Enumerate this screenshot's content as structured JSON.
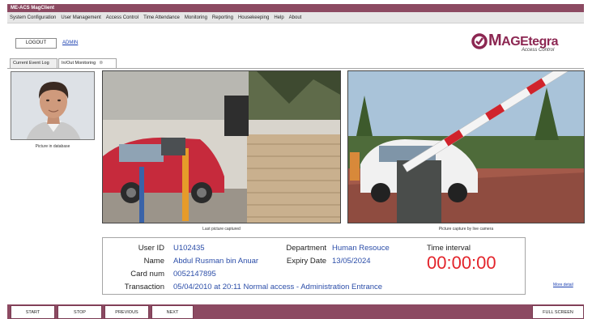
{
  "app": {
    "title": "ME-ACS MagClient"
  },
  "menu": [
    "System Configuration",
    "User Management",
    "Access Control",
    "Time Attendance",
    "Monitoring",
    "Reporting",
    "Housekeeping",
    "Help",
    "About"
  ],
  "header": {
    "logout_label": "LOGOUT",
    "user_link": "ADMIN"
  },
  "logo": {
    "brand_prefix": "M",
    "brand_rest": "AGEtegra",
    "subtitle": "Access Control"
  },
  "tabs": [
    {
      "label": "Current Event Log",
      "active": false
    },
    {
      "label": "In/Out Monitoring",
      "active": true
    }
  ],
  "captions": {
    "database_photo": "Picture in database",
    "last_captured": "Last picture captured",
    "live_camera": "Picture capture by live camera"
  },
  "record": {
    "labels": {
      "user_id": "User ID",
      "name": "Name",
      "card_num": "Card num",
      "transaction": "Transaction",
      "department": "Department",
      "expiry_date": "Expiry Date",
      "time_interval": "Time interval"
    },
    "user_id": "U102435",
    "name": "Abdul Rusman bin Anuar",
    "card_num": "0052147895",
    "transaction": "05/04/2010 at 20:11 Normal access - Administration Entrance",
    "department": "Human Resouce",
    "expiry_date": "13/05/2024",
    "time_interval": "00:00:00"
  },
  "links": {
    "more_detail": "More detail"
  },
  "controls": {
    "start": "START",
    "stop": "STOP",
    "previous": "PREVIOUS",
    "next": "NEXT",
    "full_screen": "FULL SCREEN"
  },
  "colors": {
    "brand": "#8c4a62",
    "value_text": "#2b4da8",
    "timer": "#e3242b"
  }
}
